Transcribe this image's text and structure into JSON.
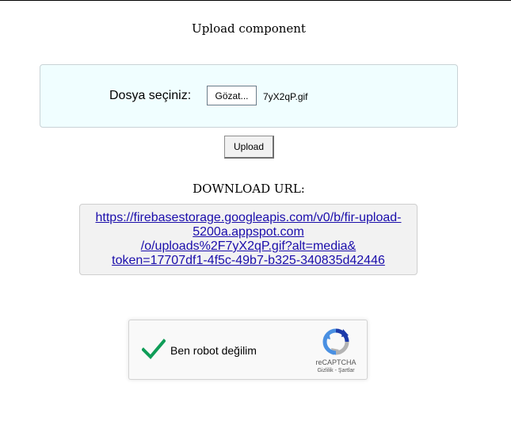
{
  "page": {
    "title": "Upload component"
  },
  "upload": {
    "file_label": "Dosya seçiniz:",
    "browse_label": "Gözat...",
    "file_name": "7yX2qP.gif",
    "upload_label": "Upload"
  },
  "download": {
    "heading": "DOWNLOAD URL:",
    "url_lines": [
      "https://firebasestorage.googleapis.com/v0/b/fir-upload-",
      "5200a.appspot.com",
      "/o/uploads%2F7yX2qP.gif?alt=media&",
      "token=17707df1-4f5c-49b7-b325-340835d42446"
    ]
  },
  "recaptcha": {
    "label": "Ben robot değilim",
    "brand": "reCAPTCHA",
    "privacy_link": "Gizlilik",
    "separator": " - ",
    "terms_link": "Şartlar",
    "checked": true,
    "check_icon": "checkmark-icon",
    "logo_icon": "recaptcha-logo-icon"
  },
  "colors": {
    "panel_bg": "#f0feff",
    "link": "#1a0dab",
    "check": "#0f9d58",
    "recaptcha_blue": "#1c3aa9",
    "recaptcha_lightblue": "#4a90e2",
    "recaptcha_gray": "#b3b3b3"
  }
}
